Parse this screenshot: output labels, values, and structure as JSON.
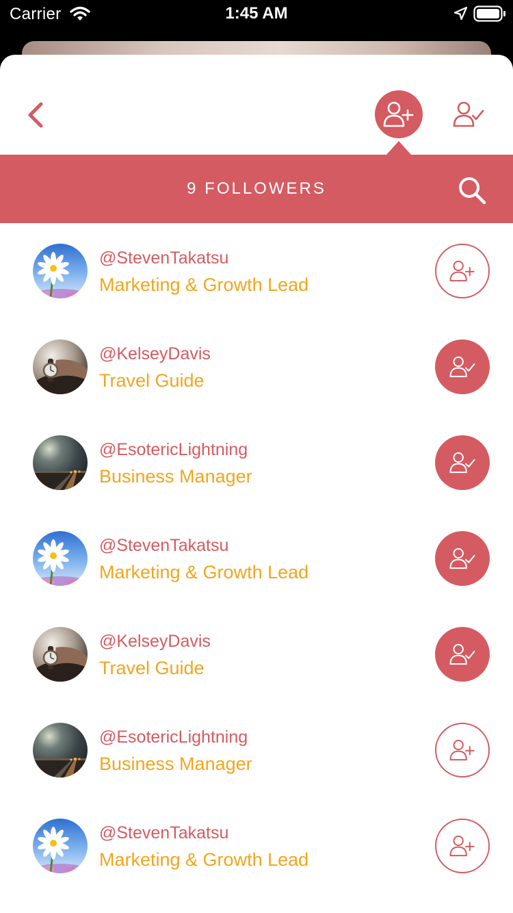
{
  "status_bar": {
    "carrier": "Carrier",
    "time": "1:45 AM"
  },
  "colors": {
    "accent": "#d45b61",
    "role_text": "#f2a51c",
    "background": "#ffffff"
  },
  "header": {
    "back_icon": "chevron-left-icon",
    "tabs": [
      {
        "name": "followers",
        "icon": "user-add-icon",
        "selected": true
      },
      {
        "name": "following",
        "icon": "user-check-icon",
        "selected": false
      }
    ]
  },
  "banner": {
    "title": "9 FOLLOWERS",
    "search_icon": "search-icon"
  },
  "followers": [
    {
      "handle": "@StevenTakatsu",
      "role": "Marketing & Growth Lead",
      "avatar": "daisy-photo",
      "following": false
    },
    {
      "handle": "@KelseyDavis",
      "role": "Travel Guide",
      "avatar": "watch-photo",
      "following": true
    },
    {
      "handle": "@EsotericLightning",
      "role": "Business Manager",
      "avatar": "night-road-photo",
      "following": true
    },
    {
      "handle": "@StevenTakatsu",
      "role": "Marketing & Growth Lead",
      "avatar": "daisy-photo",
      "following": true
    },
    {
      "handle": "@KelseyDavis",
      "role": "Travel Guide",
      "avatar": "watch-photo",
      "following": true
    },
    {
      "handle": "@EsotericLightning",
      "role": "Business Manager",
      "avatar": "night-road-photo",
      "following": false
    },
    {
      "handle": "@StevenTakatsu",
      "role": "Marketing & Growth Lead",
      "avatar": "daisy-photo",
      "following": false
    }
  ]
}
